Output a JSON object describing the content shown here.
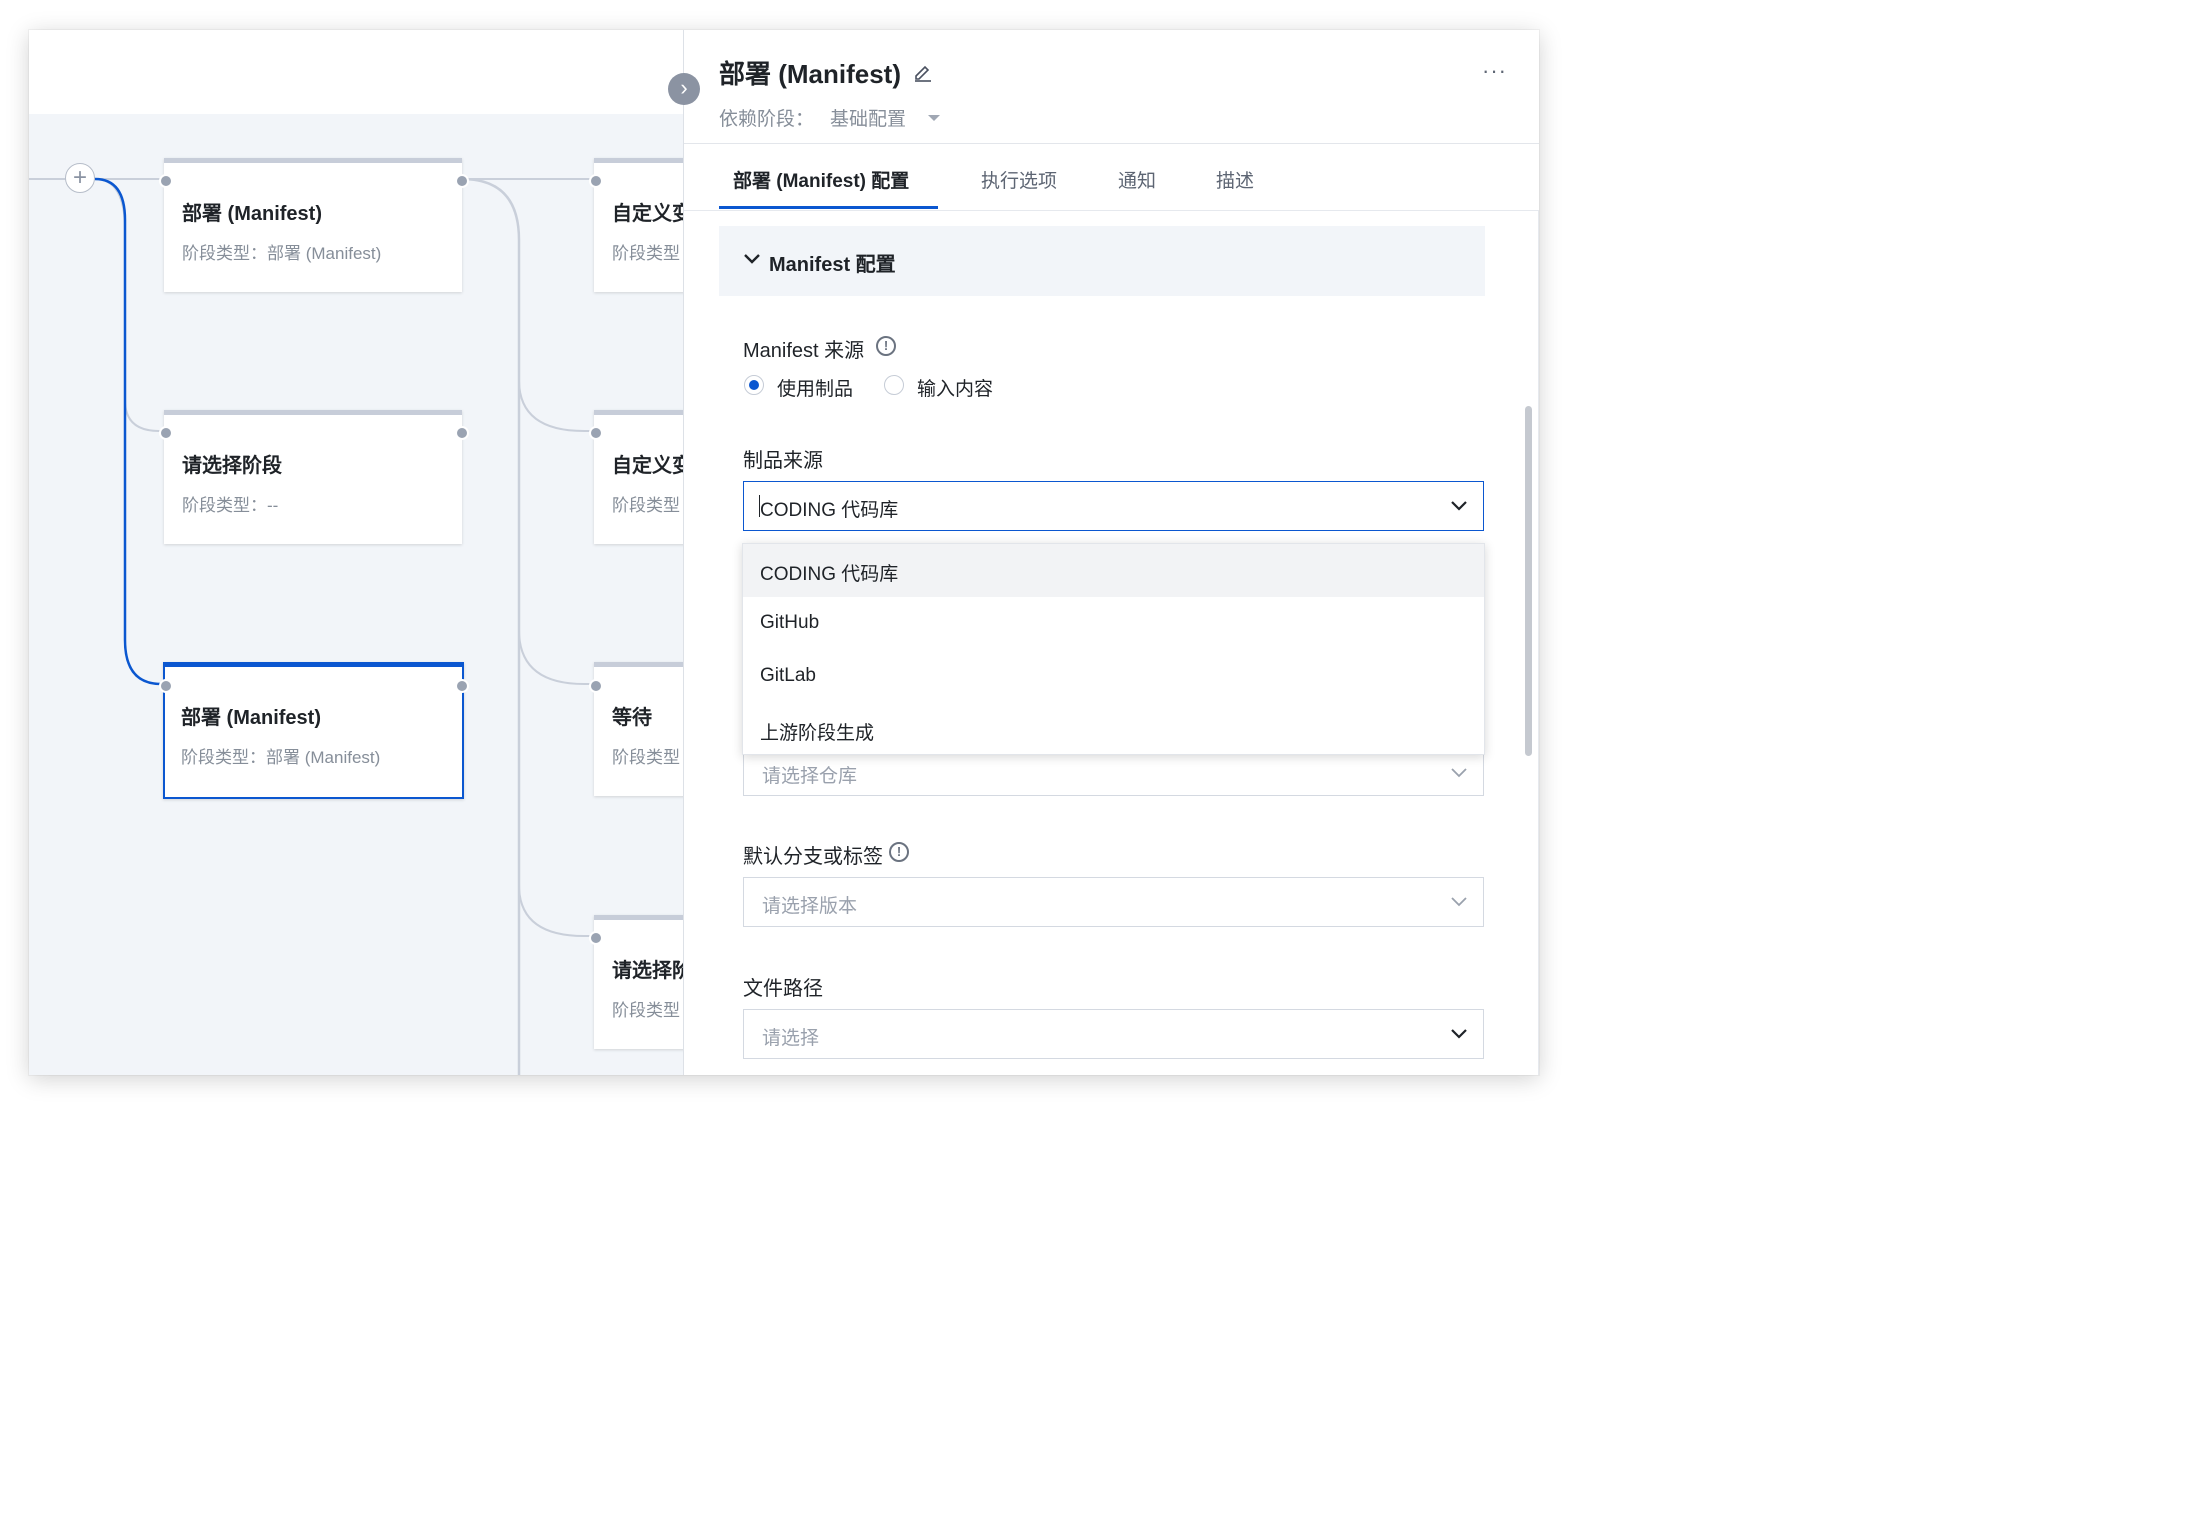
{
  "canvas": {
    "stages_left": [
      {
        "title": "部署 (Manifest)",
        "sub": "阶段类型：部署 (Manifest)"
      },
      {
        "title": "请选择阶段",
        "sub": "阶段类型：--"
      },
      {
        "title": "部署 (Manifest)",
        "sub": "阶段类型：部署 (Manifest)"
      }
    ],
    "stages_right": [
      {
        "title": "自定义变",
        "sub": "阶段类型"
      },
      {
        "title": "自定义变",
        "sub": "阶段类型"
      },
      {
        "title": "等待",
        "sub": "阶段类型"
      },
      {
        "title": "请选择阶",
        "sub": "阶段类型"
      }
    ],
    "add_symbol": "+",
    "collapse_symbol": "›",
    "colors": {
      "selected": "#0b57d0",
      "connector": "#c9cfda"
    }
  },
  "panel": {
    "title": "部署 (Manifest)",
    "more_symbol": "···",
    "dependency_label": "依赖阶段：",
    "dependency_value": "基础配置",
    "tabs": [
      {
        "label": "部署 (Manifest) 配置",
        "active": true
      },
      {
        "label": "执行选项",
        "active": false
      },
      {
        "label": "通知",
        "active": false
      },
      {
        "label": "描述",
        "active": false
      }
    ],
    "section_title": "Manifest 配置",
    "manifest_source": {
      "label": "Manifest 来源",
      "options": [
        {
          "label": "使用制品",
          "checked": true
        },
        {
          "label": "输入内容",
          "checked": false
        }
      ]
    },
    "artifact_source": {
      "label": "制品来源",
      "value": "CODING 代码库",
      "dropdown_options": [
        "CODING 代码库",
        "GitHub",
        "GitLab",
        "上游阶段生成"
      ]
    },
    "repository": {
      "placeholder": "请选择仓库"
    },
    "default_branch": {
      "label": "默认分支或标签",
      "placeholder": "请选择版本"
    },
    "file_path": {
      "label": "文件路径",
      "placeholder": "请选择"
    },
    "info_symbol": "!"
  }
}
